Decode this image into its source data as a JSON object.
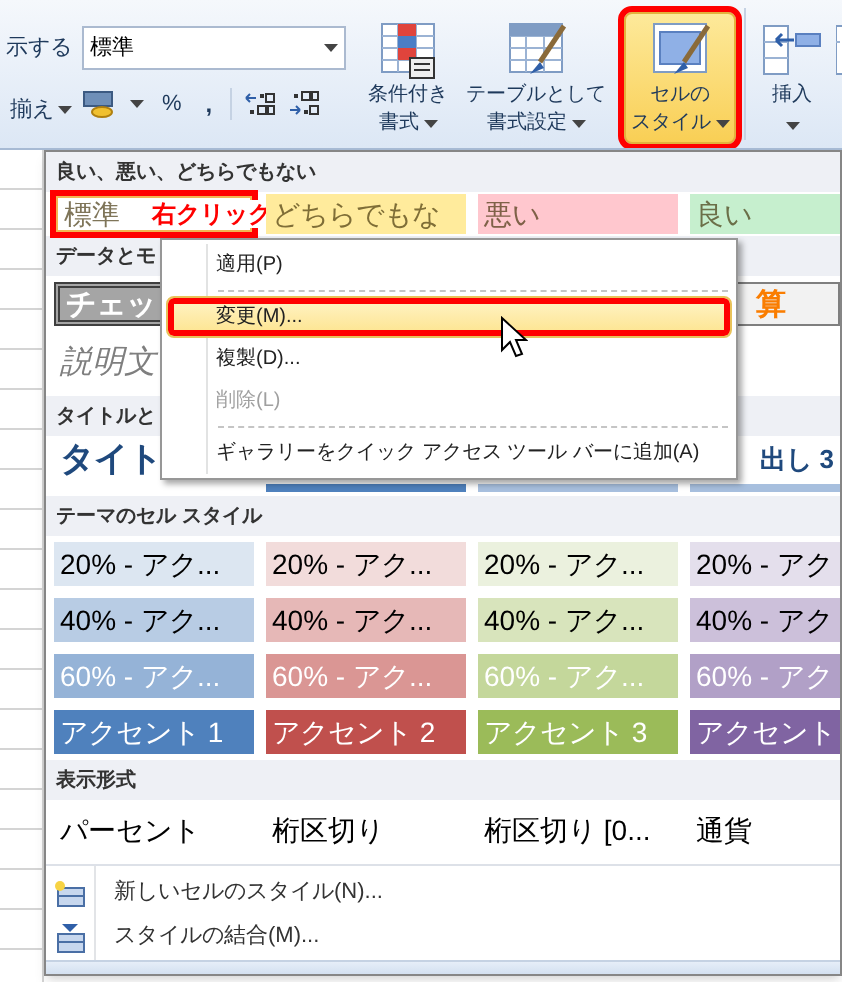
{
  "ribbon": {
    "cut_labels": [
      {
        "label": "示する",
        "dropdown": false
      },
      {
        "label": "揃え",
        "dropdown": true
      }
    ],
    "number_format": {
      "value": "標準"
    },
    "number_symbols": [
      "%",
      ","
    ],
    "buttons": [
      {
        "kind": "conditional",
        "lines": [
          "条件付き",
          "書式"
        ],
        "selected": false,
        "highlighted": false
      },
      {
        "kind": "table",
        "lines": [
          "テーブルとして",
          "書式設定"
        ],
        "selected": false,
        "highlighted": false
      },
      {
        "kind": "cellstyle",
        "lines": [
          "セルの",
          "スタイル"
        ],
        "selected": true,
        "highlighted": true
      },
      {
        "kind": "insert",
        "lines": [
          "挿入"
        ],
        "selected": false,
        "highlighted": false
      },
      {
        "kind": "delete",
        "selected": false,
        "highlighted": false
      }
    ]
  },
  "gallery": {
    "sections": [
      {
        "title": "良い、悪い、どちらでもない",
        "rows": [
          {
            "kind": "tinted",
            "cells": [
              {
                "label": "標準",
                "color": "#ffffff",
                "selected": true,
                "highlighted": true,
                "callout": "右クリック"
              },
              {
                "label": "どちらでもな",
                "color": "#ffeb9c",
                "selected": false,
                "highlighted": false
              },
              {
                "label": "悪い",
                "color": "#ffc7ce",
                "selected": false,
                "highlighted": false
              },
              {
                "label": "良い",
                "color": "#c6efce",
                "selected": false,
                "highlighted": false
              }
            ]
          }
        ]
      },
      {
        "title": "データとモ",
        "rows": [
          {
            "kind": "check",
            "cells": [
              {
                "label": "チェッ"
              },
              {
                "label": "算"
              }
            ]
          },
          {
            "kind": "italic",
            "cells": [
              {
                "label": "説明文"
              }
            ]
          }
        ]
      },
      {
        "title": "タイトルと",
        "rows": [
          {
            "kind": "title",
            "cells": [
              {
                "label": "タイト"
              },
              {
                "label": "出し 3"
              }
            ],
            "rules": [
              {
                "color": "#4f81bd"
              },
              {
                "color": "#a7bfde"
              },
              {
                "color": "#a7bfde"
              }
            ]
          }
        ]
      },
      {
        "title": "テーマのセル スタイル",
        "rows": [
          {
            "kind": "dark-text",
            "cells": [
              {
                "label": "20% - アク...",
                "color": "#dce6f1"
              },
              {
                "label": "20% - アク...",
                "color": "#f2dcdb"
              },
              {
                "label": "20% - アク...",
                "color": "#ebf1de"
              },
              {
                "label": "20% - アク",
                "color": "#e4dfec"
              }
            ]
          },
          {
            "kind": "dark-text",
            "cells": [
              {
                "label": "40% - アク...",
                "color": "#b8cce4"
              },
              {
                "label": "40% - アク...",
                "color": "#e6b8b7"
              },
              {
                "label": "40% - アク...",
                "color": "#d8e4bc"
              },
              {
                "label": "40% - アク",
                "color": "#ccc0da"
              }
            ]
          },
          {
            "kind": "light-text",
            "cells": [
              {
                "label": "60% - アク...",
                "color": "#95b3d7"
              },
              {
                "label": "60% - アク...",
                "color": "#da9694"
              },
              {
                "label": "60% - アク...",
                "color": "#c4d79b"
              },
              {
                "label": "60% - アク",
                "color": "#b1a0c7"
              }
            ]
          },
          {
            "kind": "light-text",
            "cells": [
              {
                "label": "アクセント 1",
                "color": "#4f81bd"
              },
              {
                "label": "アクセント 2",
                "color": "#c0504d"
              },
              {
                "label": "アクセント 3",
                "color": "#9bbb59"
              },
              {
                "label": "アクセント",
                "color": "#8064a2"
              }
            ]
          }
        ]
      },
      {
        "title": "表示形式",
        "rows": [
          {
            "kind": "plain",
            "cells": [
              {
                "label": "パーセント"
              },
              {
                "label": "桁区切り"
              },
              {
                "label": "桁区切り [0..."
              },
              {
                "label": "通貨"
              }
            ]
          }
        ]
      }
    ],
    "commands": [
      {
        "kind": "new",
        "label": "新しいセルのスタイル(N)..."
      },
      {
        "kind": "merge",
        "label": "スタイルの結合(M)..."
      }
    ]
  },
  "context_menu": {
    "items": [
      {
        "kind": "item",
        "label": "適用(P)",
        "selected": false,
        "disabled": false,
        "highlighted": false
      },
      {
        "kind": "separator"
      },
      {
        "kind": "item",
        "label": "変更(M)...",
        "selected": true,
        "disabled": false,
        "highlighted": true
      },
      {
        "kind": "item",
        "label": "複製(D)...",
        "selected": false,
        "disabled": false,
        "highlighted": false
      },
      {
        "kind": "item",
        "label": "削除(L)",
        "selected": false,
        "disabled": true,
        "highlighted": false
      },
      {
        "kind": "separator"
      },
      {
        "kind": "item",
        "label": "ギャラリーをクイック アクセス ツール バーに追加(A)",
        "selected": false,
        "disabled": false,
        "highlighted": false
      }
    ]
  }
}
